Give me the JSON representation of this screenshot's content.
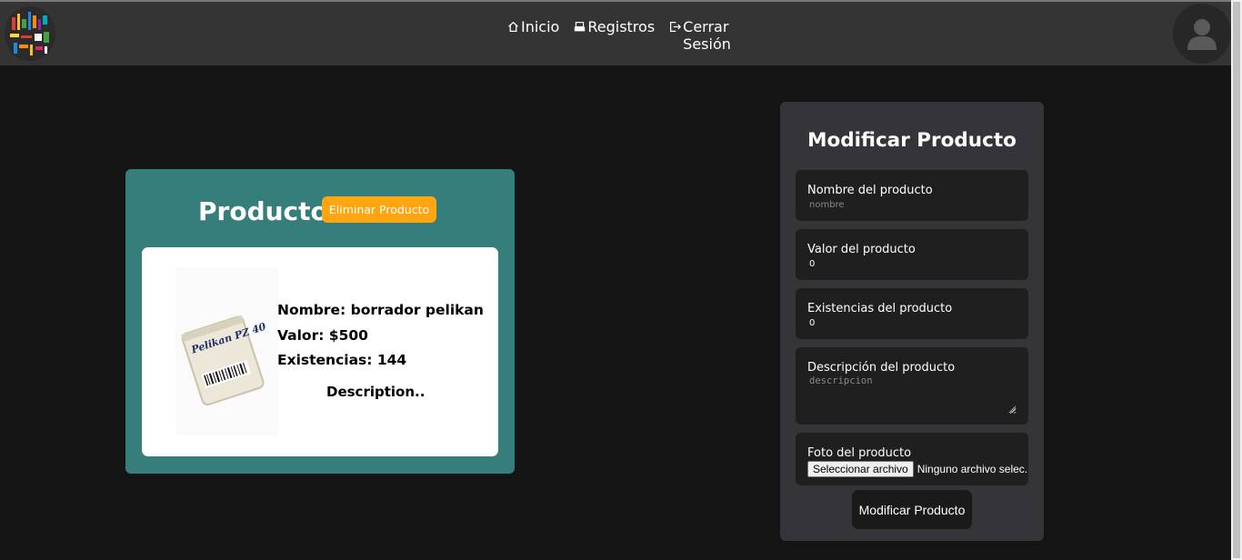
{
  "navbar": {
    "links": [
      {
        "label": "Inicio",
        "icon": "home-icon"
      },
      {
        "label": "Registros",
        "icon": "register-icon"
      },
      {
        "label": "Cerrar Sesión",
        "icon": "logout-icon"
      }
    ]
  },
  "product": {
    "title": "Producto",
    "delete_label": "Eliminar Producto",
    "name_line": "Nombre: borrador pelikan",
    "value_line": "Valor: $500",
    "stock_line": "Existencias: 144",
    "description": "Description..",
    "image_text": "Pelikan PZ 40"
  },
  "form": {
    "title": "Modificar Producto",
    "fields": [
      {
        "label": "Nombre del producto",
        "placeholder": "nombre",
        "value": ""
      },
      {
        "label": "Valor del producto",
        "placeholder": "",
        "value": "0"
      },
      {
        "label": "Existencias del producto",
        "placeholder": "",
        "value": "0"
      },
      {
        "label": "Descripción del producto",
        "placeholder": "descripcion",
        "value": ""
      },
      {
        "label": "Foto del producto"
      }
    ],
    "file_button": "Seleccionar archivo",
    "file_status": "Ninguno archivo selec.",
    "submit_label": "Modificar Producto"
  },
  "colors": {
    "navbar_bg": "#343434",
    "page_bg": "#141414",
    "product_panel": "#367e7c",
    "delete_button": "#ffa50f",
    "form_panel": "#353438",
    "field_bg": "#1f1f1f"
  }
}
